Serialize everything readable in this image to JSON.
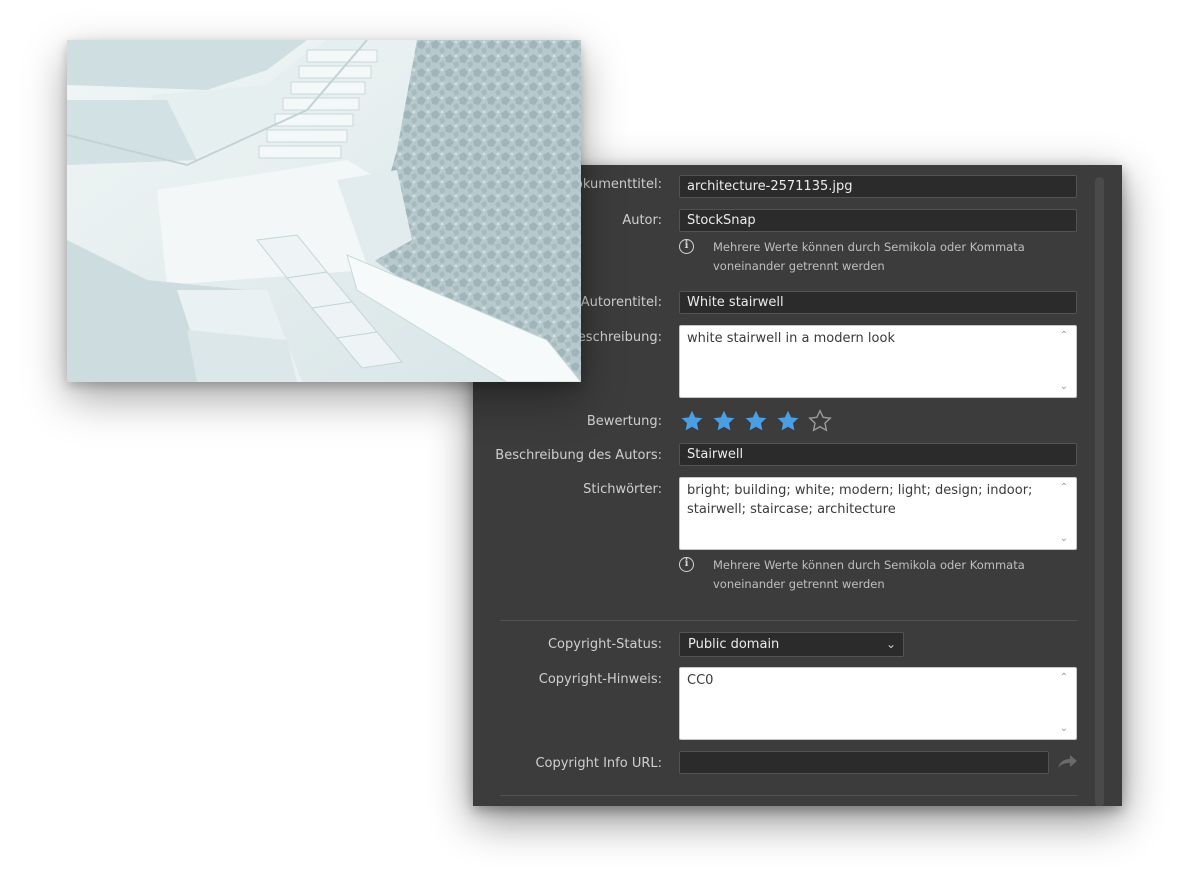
{
  "metadata": {
    "document_title": {
      "label": "Dokumenttitel:",
      "value": "architecture-2571135.jpg"
    },
    "author": {
      "label": "Autor:",
      "value": "StockSnap"
    },
    "author_hint": "Mehrere Werte können durch Semikola oder Kommata voneinander getrennt werden",
    "author_title": {
      "label": "Autorentitel:",
      "value": "White stairwell"
    },
    "description": {
      "label": "Beschreibung:",
      "value": "white stairwell in a modern look"
    },
    "rating": {
      "label": "Bewertung:",
      "value": 4,
      "max": 5,
      "color": "#4a9fe4"
    },
    "author_description": {
      "label": "Beschreibung des Autors:",
      "value": "Stairwell"
    },
    "keywords": {
      "label": "Stichwörter:",
      "value": "bright; building; white; modern; light; design; indoor; stairwell; staircase; architecture"
    },
    "keywords_hint": "Mehrere Werte können durch Semikola oder Kommata voneinander getrennt werden",
    "copyright_status": {
      "label": "Copyright-Status:",
      "value": "Public domain"
    },
    "copyright_notice": {
      "label": "Copyright-Hinweis:",
      "value": "CC0"
    },
    "copyright_url": {
      "label": "Copyright Info URL:",
      "value": ""
    }
  },
  "icons": [
    "info-icon",
    "star-icon",
    "chevron-down-icon",
    "chevron-up-icon",
    "share-arrow-icon"
  ],
  "colors": {
    "panel_bg": "#3c3c3c",
    "field_bg": "#2b2b2b",
    "accent": "#4a9fe4"
  }
}
